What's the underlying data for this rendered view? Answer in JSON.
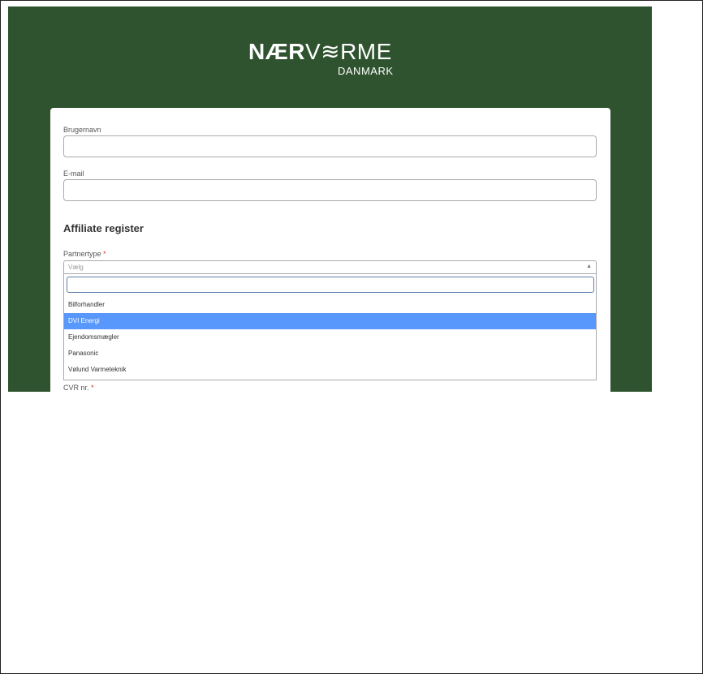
{
  "brand": {
    "logo_part1": "NÆR",
    "logo_part2": "V≋RME",
    "logo_sub": "DANMARK"
  },
  "form": {
    "username_label": "Brugernavn",
    "username_value": "",
    "email_label": "E-mail",
    "email_value": "",
    "section_title": "Affiliate register",
    "partnertype_label": "Partnertype",
    "required_marker": "*",
    "partnertype_placeholder": "Vælg",
    "search_value": "",
    "options": [
      "Bilforhandler",
      "DVI Energi",
      "Ejendomsmægler",
      "Panasonic",
      "Vølund Varmeteknik"
    ],
    "highlighted_option": "DVI Energi",
    "cvr_label": "CVR nr."
  },
  "colors": {
    "background": "#2f532f",
    "highlight": "#5897fb",
    "required": "#d9342b"
  }
}
